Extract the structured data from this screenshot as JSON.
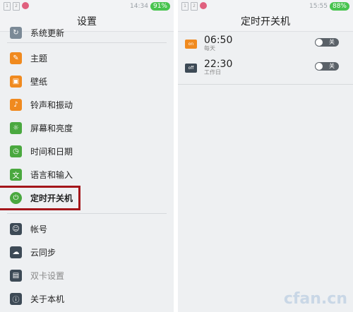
{
  "left_screen": {
    "status": {
      "time": "14:34",
      "battery": "91%"
    },
    "title": "设置",
    "items": [
      {
        "label": "系统更新",
        "icon": "system-update-icon",
        "color": "#7b8a97"
      },
      {
        "label": "主题",
        "icon": "theme-icon",
        "color": "#f08a1f"
      },
      {
        "label": "壁纸",
        "icon": "wallpaper-icon",
        "color": "#f08a1f"
      },
      {
        "label": "铃声和振动",
        "icon": "ringtone-icon",
        "color": "#f08a1f"
      },
      {
        "label": "屏幕和亮度",
        "icon": "brightness-icon",
        "color": "#4aa83f"
      },
      {
        "label": "时间和日期",
        "icon": "clock-icon",
        "color": "#4aa83f"
      },
      {
        "label": "语言和输入",
        "icon": "language-icon",
        "color": "#4aa83f"
      },
      {
        "label": "定时开关机",
        "icon": "timer-icon",
        "color": "#4aa83f"
      },
      {
        "label": "帐号",
        "icon": "account-icon",
        "color": "#3d4a56"
      },
      {
        "label": "云同步",
        "icon": "cloud-sync-icon",
        "color": "#3d4a56"
      },
      {
        "label": "双卡设置",
        "icon": "dual-sim-icon",
        "color": "#3d4a56"
      },
      {
        "label": "关于本机",
        "icon": "about-icon",
        "color": "#3d4a56"
      }
    ]
  },
  "right_screen": {
    "status": {
      "time": "15:55",
      "battery": "88%"
    },
    "title": "定时开关机",
    "alarms": [
      {
        "tag": "on",
        "time": "06:50",
        "repeat": "每天",
        "toggle": "关",
        "tag_color": "#f08a1f"
      },
      {
        "tag": "off",
        "time": "22:30",
        "repeat": "工作日",
        "toggle": "关",
        "tag_color": "#3d4a56"
      }
    ]
  },
  "watermark": "cfan.cn"
}
